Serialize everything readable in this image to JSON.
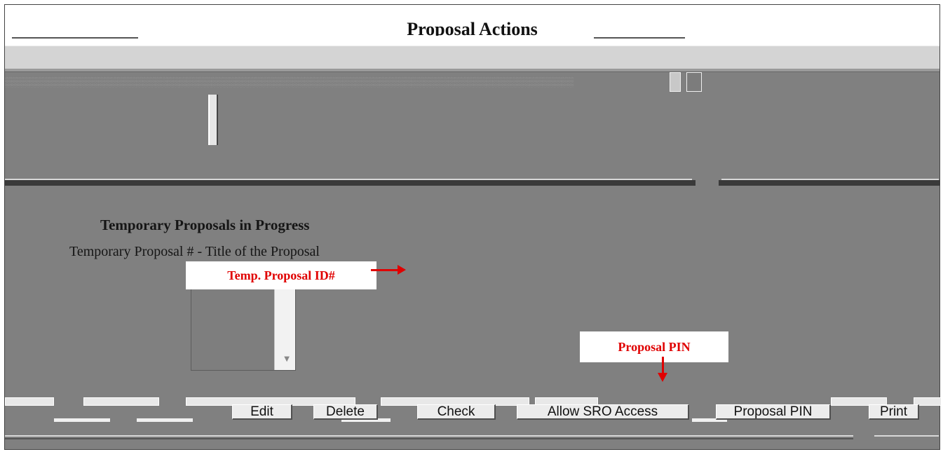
{
  "header": {
    "title": "Proposal Actions"
  },
  "section": {
    "title": "Temporary Proposals in Progress",
    "list_header": "Temporary Proposal # - Title of the Proposal"
  },
  "callouts": {
    "temp_id": "Temp. Proposal ID#",
    "pin": "Proposal PIN"
  },
  "buttons": {
    "edit": "Edit",
    "delete": "Delete",
    "check": "Check",
    "allow_sro": "Allow SRO Access",
    "proposal_pin": "Proposal PIN",
    "print": "Print"
  },
  "colors": {
    "annotation": "#e00000",
    "panel_gray": "#808080"
  }
}
